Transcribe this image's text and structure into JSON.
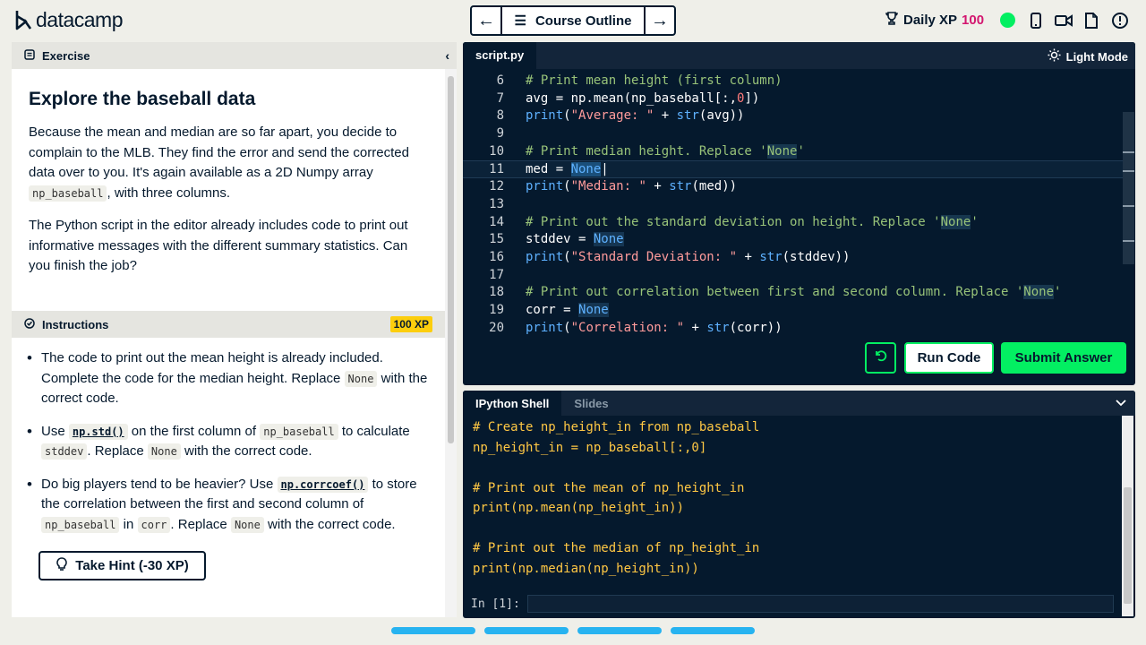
{
  "app": {
    "logo_text": "datacamp"
  },
  "header": {
    "course_outline_label": "Course Outline",
    "daily_xp_label": "Daily XP",
    "daily_xp_value": "100"
  },
  "exercise": {
    "panel_label": "Exercise",
    "title": "Explore the baseball data",
    "p1_a": "Because the mean and median are so far apart, you decide to complain to the MLB. They find the error and send the corrected data over to you. It's again available as a 2D Numpy array ",
    "p1_code": "np_baseball",
    "p1_b": ", with three columns.",
    "p2": "The Python script in the editor already includes code to print out informative messages with the different summary statistics. Can you finish the job?"
  },
  "instructions": {
    "label": "Instructions",
    "xp_badge": "100 XP",
    "items": [
      {
        "a": "The code to print out the mean height is already included. Complete the code for the median height. Replace ",
        "c1": "None",
        "b": " with the correct code."
      },
      {
        "a": "Use ",
        "fn": "np.std()",
        "b": " on the first column of ",
        "c1": "np_baseball",
        "c": " to calculate ",
        "c2": "stddev",
        "d": ". Replace ",
        "c3": "None",
        "e": " with the correct code."
      },
      {
        "a": "Do big players tend to be heavier? Use ",
        "fn": "np.corrcoef()",
        "b": " to store the correlation between the first and second column of ",
        "c1": "np_baseball",
        "c": " in ",
        "c2": "corr",
        "d": ". Replace ",
        "c3": "None",
        "e": " with the correct code."
      }
    ],
    "hint_label": "Take Hint (-30 XP)"
  },
  "editor": {
    "tab": "script.py",
    "light_mode_label": "Light Mode",
    "line_numbers": [
      "6",
      "7",
      "8",
      "9",
      "10",
      "11",
      "12",
      "13",
      "14",
      "15",
      "16",
      "17",
      "18",
      "19",
      "20"
    ],
    "run_label": "Run Code",
    "submit_label": "Submit Answer"
  },
  "shell": {
    "tab_active": "IPython Shell",
    "tab_inactive": "Slides",
    "lines": [
      "# Create np_height_in from np_baseball",
      "np_height_in = np_baseball[:,0]",
      "",
      "# Print out the mean of np_height_in",
      "print(np.mean(np_height_in))",
      "",
      "# Print out the median of np_height_in",
      "print(np.median(np_height_in))"
    ],
    "prompt": "In [1]:"
  },
  "colors": {
    "brand_green": "#03ef62",
    "navy": "#05192d",
    "xp_pink": "#d3166f",
    "badge_yellow": "#fcce0d",
    "progress_blue": "#27b3f0"
  },
  "icons": [
    "logo-icon",
    "arrow-left-icon",
    "menu-icon",
    "arrow-right-icon",
    "trophy-icon",
    "mobile-icon",
    "video-icon",
    "document-icon",
    "alert-icon",
    "exercise-icon",
    "chevron-left-icon",
    "instructions-icon",
    "lightbulb-icon",
    "sun-icon",
    "reset-icon",
    "chevron-down-icon"
  ]
}
